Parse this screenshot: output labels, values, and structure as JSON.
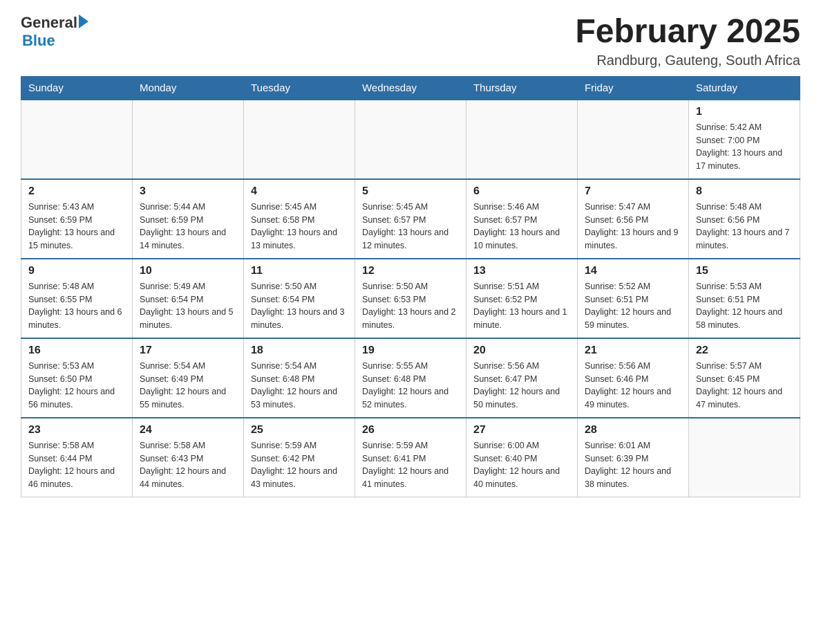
{
  "header": {
    "logo_general": "General",
    "logo_blue": "Blue",
    "title": "February 2025",
    "subtitle": "Randburg, Gauteng, South Africa"
  },
  "weekdays": [
    "Sunday",
    "Monday",
    "Tuesday",
    "Wednesday",
    "Thursday",
    "Friday",
    "Saturday"
  ],
  "weeks": [
    [
      {
        "day": "",
        "info": ""
      },
      {
        "day": "",
        "info": ""
      },
      {
        "day": "",
        "info": ""
      },
      {
        "day": "",
        "info": ""
      },
      {
        "day": "",
        "info": ""
      },
      {
        "day": "",
        "info": ""
      },
      {
        "day": "1",
        "info": "Sunrise: 5:42 AM\nSunset: 7:00 PM\nDaylight: 13 hours and 17 minutes."
      }
    ],
    [
      {
        "day": "2",
        "info": "Sunrise: 5:43 AM\nSunset: 6:59 PM\nDaylight: 13 hours and 15 minutes."
      },
      {
        "day": "3",
        "info": "Sunrise: 5:44 AM\nSunset: 6:59 PM\nDaylight: 13 hours and 14 minutes."
      },
      {
        "day": "4",
        "info": "Sunrise: 5:45 AM\nSunset: 6:58 PM\nDaylight: 13 hours and 13 minutes."
      },
      {
        "day": "5",
        "info": "Sunrise: 5:45 AM\nSunset: 6:57 PM\nDaylight: 13 hours and 12 minutes."
      },
      {
        "day": "6",
        "info": "Sunrise: 5:46 AM\nSunset: 6:57 PM\nDaylight: 13 hours and 10 minutes."
      },
      {
        "day": "7",
        "info": "Sunrise: 5:47 AM\nSunset: 6:56 PM\nDaylight: 13 hours and 9 minutes."
      },
      {
        "day": "8",
        "info": "Sunrise: 5:48 AM\nSunset: 6:56 PM\nDaylight: 13 hours and 7 minutes."
      }
    ],
    [
      {
        "day": "9",
        "info": "Sunrise: 5:48 AM\nSunset: 6:55 PM\nDaylight: 13 hours and 6 minutes."
      },
      {
        "day": "10",
        "info": "Sunrise: 5:49 AM\nSunset: 6:54 PM\nDaylight: 13 hours and 5 minutes."
      },
      {
        "day": "11",
        "info": "Sunrise: 5:50 AM\nSunset: 6:54 PM\nDaylight: 13 hours and 3 minutes."
      },
      {
        "day": "12",
        "info": "Sunrise: 5:50 AM\nSunset: 6:53 PM\nDaylight: 13 hours and 2 minutes."
      },
      {
        "day": "13",
        "info": "Sunrise: 5:51 AM\nSunset: 6:52 PM\nDaylight: 13 hours and 1 minute."
      },
      {
        "day": "14",
        "info": "Sunrise: 5:52 AM\nSunset: 6:51 PM\nDaylight: 12 hours and 59 minutes."
      },
      {
        "day": "15",
        "info": "Sunrise: 5:53 AM\nSunset: 6:51 PM\nDaylight: 12 hours and 58 minutes."
      }
    ],
    [
      {
        "day": "16",
        "info": "Sunrise: 5:53 AM\nSunset: 6:50 PM\nDaylight: 12 hours and 56 minutes."
      },
      {
        "day": "17",
        "info": "Sunrise: 5:54 AM\nSunset: 6:49 PM\nDaylight: 12 hours and 55 minutes."
      },
      {
        "day": "18",
        "info": "Sunrise: 5:54 AM\nSunset: 6:48 PM\nDaylight: 12 hours and 53 minutes."
      },
      {
        "day": "19",
        "info": "Sunrise: 5:55 AM\nSunset: 6:48 PM\nDaylight: 12 hours and 52 minutes."
      },
      {
        "day": "20",
        "info": "Sunrise: 5:56 AM\nSunset: 6:47 PM\nDaylight: 12 hours and 50 minutes."
      },
      {
        "day": "21",
        "info": "Sunrise: 5:56 AM\nSunset: 6:46 PM\nDaylight: 12 hours and 49 minutes."
      },
      {
        "day": "22",
        "info": "Sunrise: 5:57 AM\nSunset: 6:45 PM\nDaylight: 12 hours and 47 minutes."
      }
    ],
    [
      {
        "day": "23",
        "info": "Sunrise: 5:58 AM\nSunset: 6:44 PM\nDaylight: 12 hours and 46 minutes."
      },
      {
        "day": "24",
        "info": "Sunrise: 5:58 AM\nSunset: 6:43 PM\nDaylight: 12 hours and 44 minutes."
      },
      {
        "day": "25",
        "info": "Sunrise: 5:59 AM\nSunset: 6:42 PM\nDaylight: 12 hours and 43 minutes."
      },
      {
        "day": "26",
        "info": "Sunrise: 5:59 AM\nSunset: 6:41 PM\nDaylight: 12 hours and 41 minutes."
      },
      {
        "day": "27",
        "info": "Sunrise: 6:00 AM\nSunset: 6:40 PM\nDaylight: 12 hours and 40 minutes."
      },
      {
        "day": "28",
        "info": "Sunrise: 6:01 AM\nSunset: 6:39 PM\nDaylight: 12 hours and 38 minutes."
      },
      {
        "day": "",
        "info": ""
      }
    ]
  ]
}
